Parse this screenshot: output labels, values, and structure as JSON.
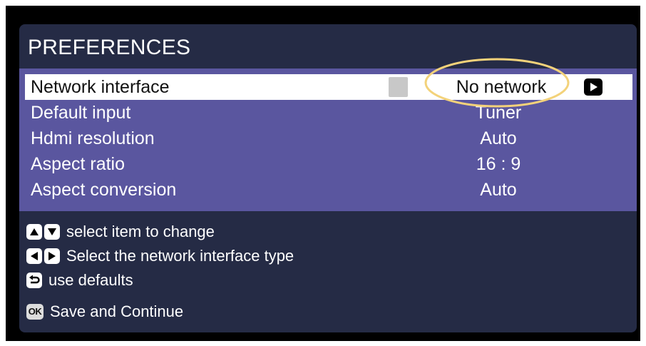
{
  "title": "PREFERENCES",
  "colors": {
    "panel_bg": "#252b45",
    "menu_bg": "#5a569f",
    "selected_row_bg": "#ffffff",
    "highlight_ellipse": "#f3d27a"
  },
  "menu": {
    "items": [
      {
        "label": "Network interface",
        "value": "No network",
        "selected": true
      },
      {
        "label": "Default input",
        "value": "Tuner",
        "selected": false
      },
      {
        "label": "Hdmi resolution",
        "value": "Auto",
        "selected": false
      },
      {
        "label": "Aspect ratio",
        "value": "16 : 9",
        "selected": false
      },
      {
        "label": "Aspect conversion",
        "value": "Auto",
        "selected": false
      }
    ]
  },
  "help": {
    "items": [
      {
        "icons": [
          "up-arrow-key-icon",
          "down-arrow-key-icon"
        ],
        "text": "select item to change"
      },
      {
        "icons": [
          "left-arrow-key-icon",
          "right-arrow-key-icon"
        ],
        "text": "Select the network interface type"
      },
      {
        "icons": [
          "back-key-icon"
        ],
        "text": "use defaults"
      },
      {
        "icons": [
          "ok-key-icon"
        ],
        "key_label": "OK",
        "text": "Save and Continue"
      }
    ]
  }
}
